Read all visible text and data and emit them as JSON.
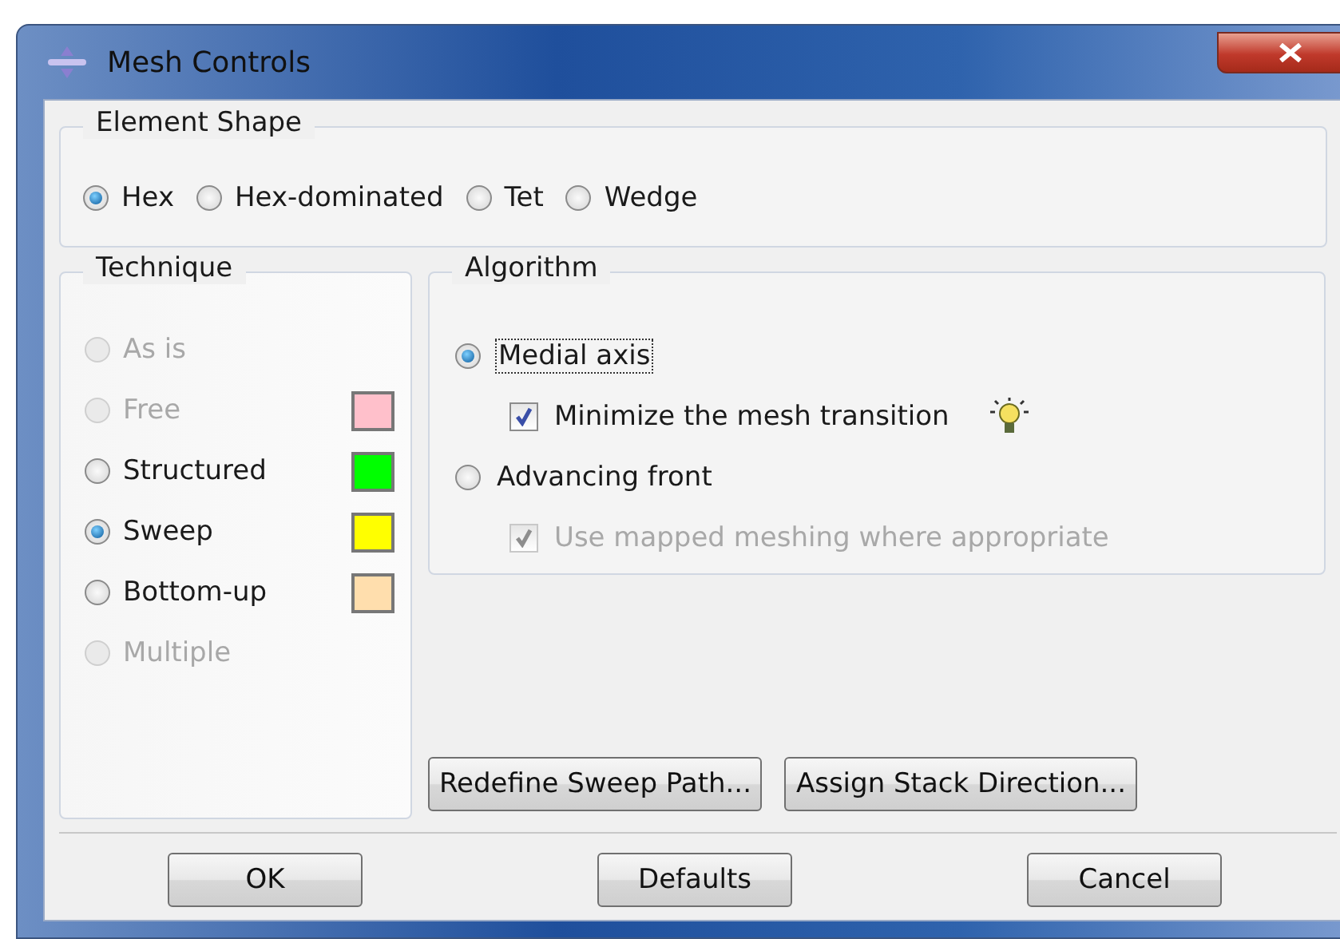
{
  "window": {
    "title": "Mesh Controls"
  },
  "element_shape": {
    "title": "Element Shape",
    "options": [
      {
        "label": "Hex",
        "selected": true
      },
      {
        "label": "Hex-dominated",
        "selected": false
      },
      {
        "label": "Tet",
        "selected": false
      },
      {
        "label": "Wedge",
        "selected": false
      }
    ]
  },
  "technique": {
    "title": "Technique",
    "options": [
      {
        "label": "As is",
        "selected": false,
        "disabled": true
      },
      {
        "label": "Free",
        "selected": false,
        "disabled": true,
        "color": "#ffc0cb"
      },
      {
        "label": "Structured",
        "selected": false,
        "disabled": false,
        "color": "#00ff00"
      },
      {
        "label": "Sweep",
        "selected": true,
        "disabled": false,
        "color": "#ffff00"
      },
      {
        "label": "Bottom-up",
        "selected": false,
        "disabled": false,
        "color": "#ffdead"
      },
      {
        "label": "Multiple",
        "selected": false,
        "disabled": true
      }
    ]
  },
  "algorithm": {
    "title": "Algorithm",
    "options": [
      {
        "kind": "radio",
        "label": "Medial axis",
        "selected": true,
        "focused": true
      },
      {
        "kind": "checkbox",
        "label": "Minimize the mesh transition",
        "checked": true,
        "disabled": false,
        "hint": true
      },
      {
        "kind": "radio",
        "label": "Advancing front",
        "selected": false,
        "focused": false
      },
      {
        "kind": "checkbox",
        "label": "Use mapped meshing where appropriate",
        "checked": true,
        "disabled": true,
        "hint": false
      }
    ]
  },
  "action_buttons": [
    "Redefine Sweep Path...",
    "Assign Stack Direction..."
  ],
  "dialog_buttons": [
    "OK",
    "Defaults",
    "Cancel"
  ]
}
